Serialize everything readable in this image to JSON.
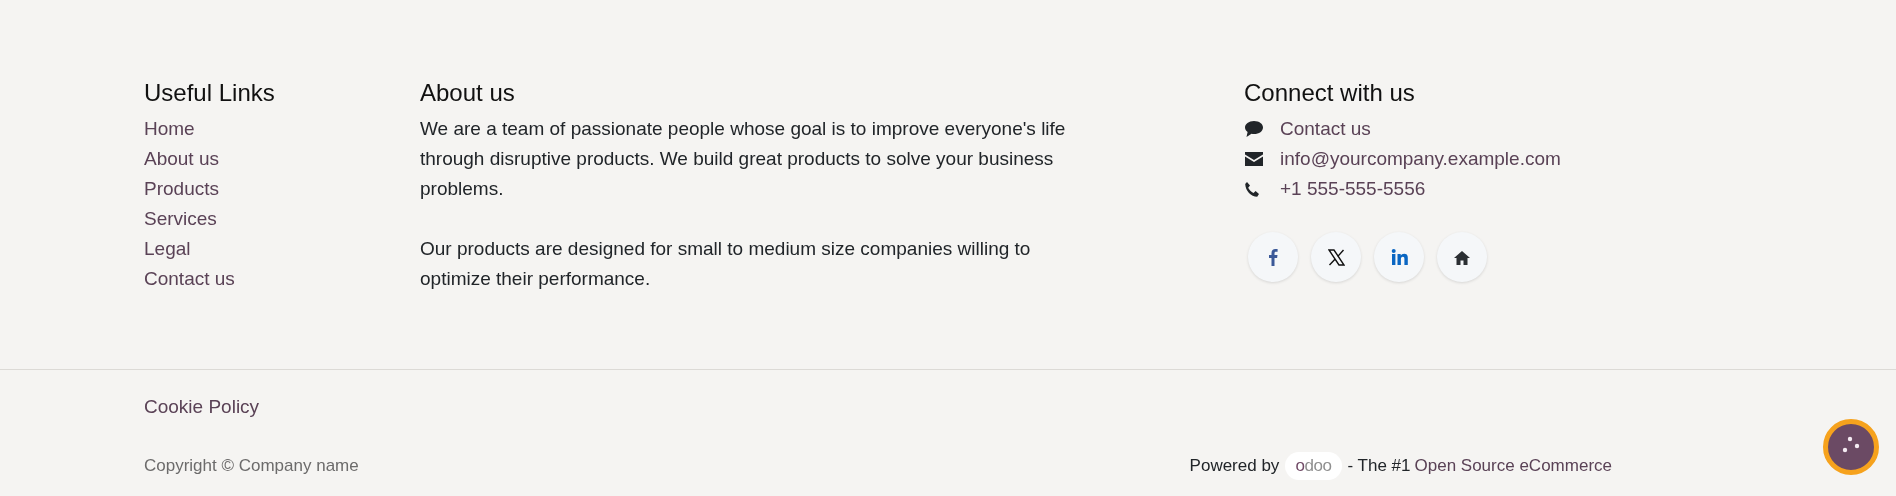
{
  "useful_links": {
    "title": "Useful Links",
    "items": [
      "Home",
      "About us",
      "Products",
      "Services",
      "Legal",
      "Contact us"
    ]
  },
  "about": {
    "title": "About us",
    "paragraphs": [
      "We are a team of passionate people whose goal is to improve everyone's life through disruptive products. We build great products to solve your business problems.",
      "Our products are designed for small to medium size companies willing to optimize their performance."
    ]
  },
  "connect": {
    "title": "Connect with us",
    "items": [
      {
        "kind": "chat",
        "text": "Contact us"
      },
      {
        "kind": "mail",
        "text": "info@yourcompany.example.com"
      },
      {
        "kind": "phone",
        "text": "+1 555-555-5556"
      }
    ],
    "social": [
      {
        "kind": "facebook"
      },
      {
        "kind": "x"
      },
      {
        "kind": "linkedin"
      },
      {
        "kind": "home"
      }
    ]
  },
  "bottom": {
    "cookie_link": "Cookie Policy",
    "copyright": "Copyright © Company name",
    "powered_by": "Powered by",
    "logo": "odoo",
    "tagline": "- The #1",
    "tagline_link": "Open Source eCommerce"
  }
}
